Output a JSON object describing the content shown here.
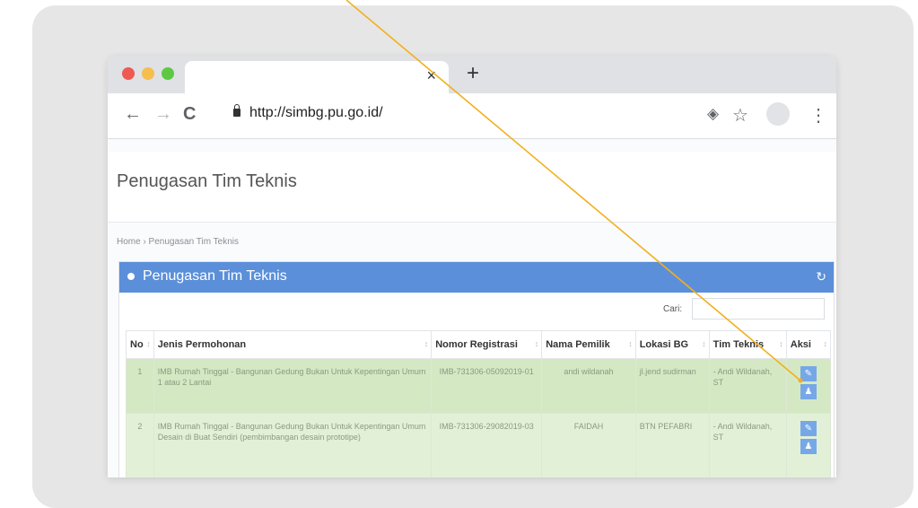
{
  "browser": {
    "tab_close": "×",
    "new_tab": "+",
    "back": "←",
    "forward": "→",
    "reload": "C",
    "url": "http://simbg.pu.go.id/",
    "location_icon": "◈",
    "star_icon": "☆",
    "menu_icon": "⋮",
    "colors": {
      "close": "#ee5a52",
      "minimize": "#f5be4f",
      "maximize": "#5dc943"
    }
  },
  "page": {
    "title": "Penugasan Tim Teknis",
    "breadcrumb": "Home › Penugasan Tim Teknis"
  },
  "panel": {
    "title": "Penugasan Tim Teknis",
    "refresh_icon": "↻",
    "search_label": "Cari:",
    "search_value": "",
    "accent": "#5b8fd9"
  },
  "table": {
    "columns": [
      "No",
      "Jenis Permohonan",
      "Nomor Registrasi",
      "Nama Pemilik",
      "Lokasi BG",
      "Tim Teknis",
      "Aksi"
    ],
    "rows": [
      {
        "no": "1",
        "jenis": "IMB Rumah Tinggal - Bangunan Gedung Bukan Untuk Kepentingan Umum 1 atau 2 Lantai",
        "nomor": "IMB-731306-05092019-01",
        "nama": "andi wildanah",
        "lokasi": "jl.jend sudirman",
        "tim": "- Andi Wildanah, ST"
      },
      {
        "no": "2",
        "jenis": "IMB Rumah Tinggal - Bangunan Gedung Bukan Untuk Kepentingan Umum Desain di Buat Sendiri (pembimbangan desain prototipe)",
        "nomor": "IMB-731306-29082019-03",
        "nama": "FAIDAH",
        "lokasi": "BTN PEFABRI",
        "tim": "- Andi Wildanah, ST"
      }
    ],
    "action_icons": {
      "edit": "✎",
      "user": "♟"
    }
  },
  "annotation": {
    "line_color": "#f2b01e"
  }
}
